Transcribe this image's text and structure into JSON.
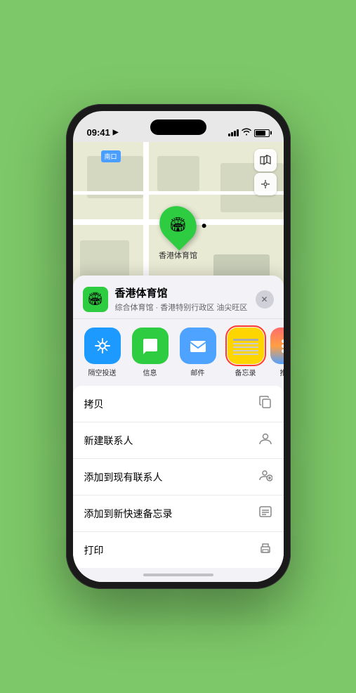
{
  "statusBar": {
    "time": "09:41",
    "locationArrow": "▶"
  },
  "map": {
    "label": "南口",
    "mapIconLabel": "🗺",
    "locationIconLabel": "⤶",
    "pinEmoji": "🏟",
    "pinLabel": "香港体育馆"
  },
  "bottomSheet": {
    "venueIconEmoji": "🏟",
    "venueName": "香港体育馆",
    "venueSub": "综合体育馆 · 香港特别行政区 油尖旺区",
    "closeLabel": "✕"
  },
  "shareRow": [
    {
      "id": "airdrop",
      "label": "隔空投送",
      "colorClass": "airdrop-icon",
      "emoji": "📡"
    },
    {
      "id": "messages",
      "label": "信息",
      "colorClass": "messages-icon",
      "emoji": "💬"
    },
    {
      "id": "mail",
      "label": "邮件",
      "colorClass": "mail-icon",
      "emoji": "✉️"
    },
    {
      "id": "notes",
      "label": "备忘录",
      "colorClass": "notes-icon",
      "emoji": "📝",
      "selected": true
    },
    {
      "id": "more",
      "label": "推",
      "colorClass": "more-icon",
      "emoji": "⋯"
    }
  ],
  "actionRows": [
    {
      "id": "copy",
      "label": "拷贝",
      "icon": "⧉"
    },
    {
      "id": "add-contact",
      "label": "新建联系人",
      "icon": "👤"
    },
    {
      "id": "add-existing",
      "label": "添加到现有联系人",
      "icon": "👤"
    },
    {
      "id": "add-note",
      "label": "添加到新快速备忘录",
      "icon": "🗂"
    },
    {
      "id": "print",
      "label": "打印",
      "icon": "🖨"
    }
  ]
}
